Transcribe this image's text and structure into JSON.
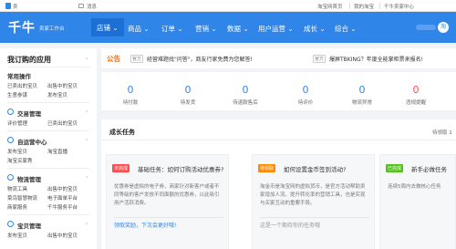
{
  "topbar": {
    "left_text": "卖",
    "messages": "消息",
    "links": [
      "淘宝网首页",
      "我的淘宝",
      "千牛卖家中心"
    ]
  },
  "header": {
    "logo": "千牛",
    "logo_sub": "卖家工作台",
    "nav": [
      "店铺",
      "商品",
      "订单",
      "营销",
      "数据",
      "用户运营",
      "成长",
      "综合"
    ],
    "active_index": 0,
    "user_initial": "淘"
  },
  "sidebar": {
    "title": "我订购的应用",
    "common_title": "常用操作",
    "common_items": [
      [
        "已卖出的宝贝",
        "出售中的宝贝"
      ],
      [
        "生意参谋",
        "发布宝贝"
      ]
    ],
    "groups": [
      {
        "name": "交易管理",
        "items": [
          [
            "评价管理",
            "已卖出的宝贝"
          ]
        ]
      },
      {
        "name": "自运营中心",
        "items": [
          [
            "发布宝贝",
            "淘宝直播"
          ],
          [
            "淘宝买家秀",
            ""
          ]
        ]
      },
      {
        "name": "物流管理",
        "items": [
          [
            "物流工具",
            "出售中的宝贝"
          ],
          [
            "菜鸟智慧物流",
            "电子面单平台"
          ],
          [
            "商家服务",
            "千牛服务平台"
          ]
        ]
      },
      {
        "name": "宝贝管理",
        "items": [
          [
            "发布宝贝",
            "出售中的宝贝"
          ]
        ]
      }
    ]
  },
  "notice": {
    "label": "公告",
    "items": [
      {
        "tag": "官方",
        "text": "经营难题找\"问答\"，商友行家免费为您解答!"
      },
      {
        "tag": "官方",
        "text": "爆屏TBKING？年度全能掌柜票来报名!"
      }
    ]
  },
  "stats": [
    {
      "value": "0",
      "label": "待付款"
    },
    {
      "value": "0",
      "label": "待发货"
    },
    {
      "value": "0",
      "label": "待退款售后"
    },
    {
      "value": "0",
      "label": "待评价"
    },
    {
      "value": "0",
      "label": "物流异常"
    },
    {
      "value": "0",
      "label": "违规提醒"
    }
  ],
  "tasks": {
    "title": "成长任务",
    "count": "待领取 1",
    "cards": [
      {
        "badge": "未完成",
        "badge_color": "#ff4d4f",
        "title": "基础任务：如何订购活动优惠券?",
        "desc": "优惠券是虚拟的电子券，商家针对新客户或者不同等级的客户发放不同面额的优惠券，以此吸引用户活跃消费。",
        "footer": "领取奖励，下次会更好哦!",
        "footer_color": "#2f86e8"
      },
      {
        "badge": "待领取",
        "badge_color": "#ff8a00",
        "title": "如何设置金币签到活动?",
        "desc": "淘金币是淘宝网的虚拟货币，是官方活动帮助卖家增加人流、提升转化率的营销工具，也是实现与买家互动的重要手段。",
        "footer": "这是一个期待你的任务哦",
        "footer_color": "#999999"
      },
      {
        "badge": "已完成",
        "badge_color": "#52c41a",
        "title": "新手必做任务",
        "desc": "连续5周内去做核心任务",
        "footer": "",
        "footer_color": "#999999"
      }
    ]
  }
}
